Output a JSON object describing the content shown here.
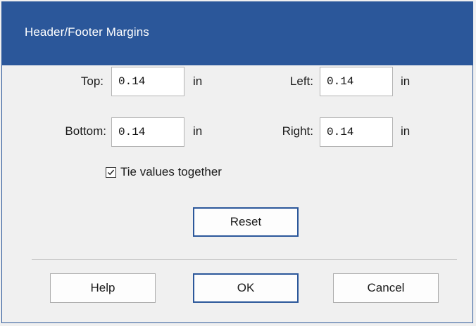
{
  "dialog": {
    "title": "Header/Footer Margins"
  },
  "fields": {
    "top": {
      "label": "Top:",
      "value": "0.14",
      "unit": "in"
    },
    "left": {
      "label": "Left:",
      "value": "0.14",
      "unit": "in"
    },
    "bottom": {
      "label": "Bottom:",
      "value": "0.14",
      "unit": "in"
    },
    "right": {
      "label": "Right:",
      "value": "0.14",
      "unit": "in"
    }
  },
  "tie_values": {
    "label": "Tie values together",
    "checked": true
  },
  "buttons": {
    "reset": "Reset",
    "help": "Help",
    "ok": "OK",
    "cancel": "Cancel"
  },
  "colors": {
    "accent": "#2b579a",
    "background": "#f0f0f0"
  },
  "icons": {
    "checkmark": "check-icon"
  }
}
